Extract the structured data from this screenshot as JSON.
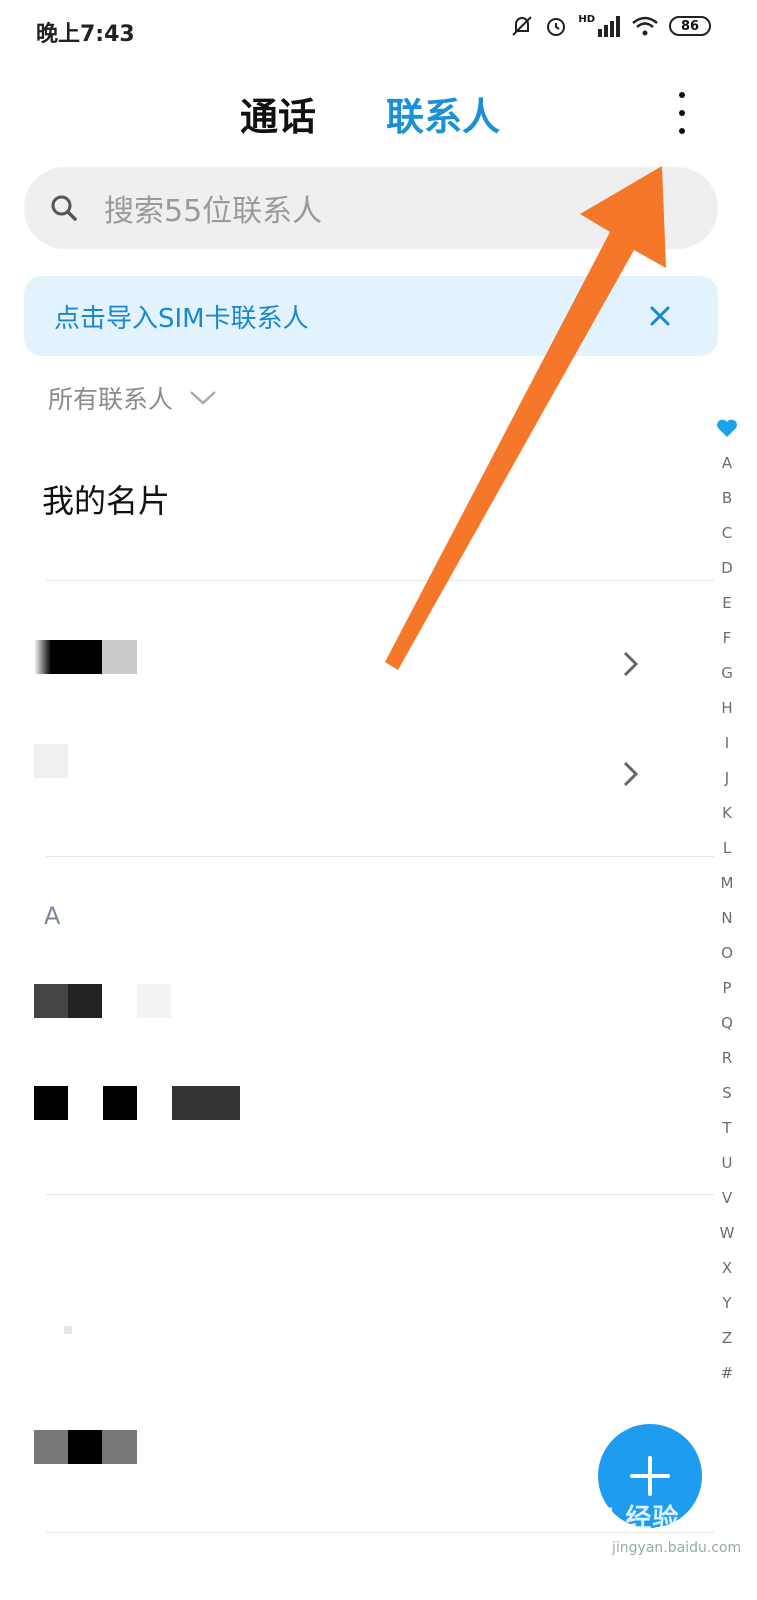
{
  "status_bar": {
    "time": "晚上7:43",
    "network": "HD",
    "battery": "86"
  },
  "header": {
    "tabs": [
      {
        "label": "通话",
        "active": false
      },
      {
        "label": "联系人",
        "active": true
      }
    ]
  },
  "search": {
    "placeholder": "搜索55位联系人"
  },
  "banner": {
    "text": "点击导入SIM卡联系人"
  },
  "filter": {
    "label": "所有联系人"
  },
  "my_card": {
    "label": "我的名片"
  },
  "section": {
    "letter": "A"
  },
  "index_bar": {
    "items": [
      "A",
      "B",
      "C",
      "D",
      "E",
      "F",
      "G",
      "H",
      "I",
      "J",
      "K",
      "L",
      "M",
      "N",
      "O",
      "P",
      "Q",
      "R",
      "S",
      "T",
      "U",
      "V",
      "W",
      "X",
      "Y",
      "Z",
      "#"
    ]
  },
  "watermark": {
    "brand": "Bai 经验",
    "url": "jingyan.baidu.com"
  },
  "colors": {
    "accent": "#1a90d9",
    "banner_bg": "#e3f3fd",
    "fab": "#1d9cf0",
    "annotation_arrow": "#f4772a"
  },
  "icons": [
    "search-icon",
    "close-icon",
    "chevron-down-icon",
    "chevron-right-icon",
    "more-icon",
    "heart-icon",
    "plus-icon",
    "mute-icon",
    "alarm-icon",
    "signal-icon",
    "wifi-icon"
  ]
}
